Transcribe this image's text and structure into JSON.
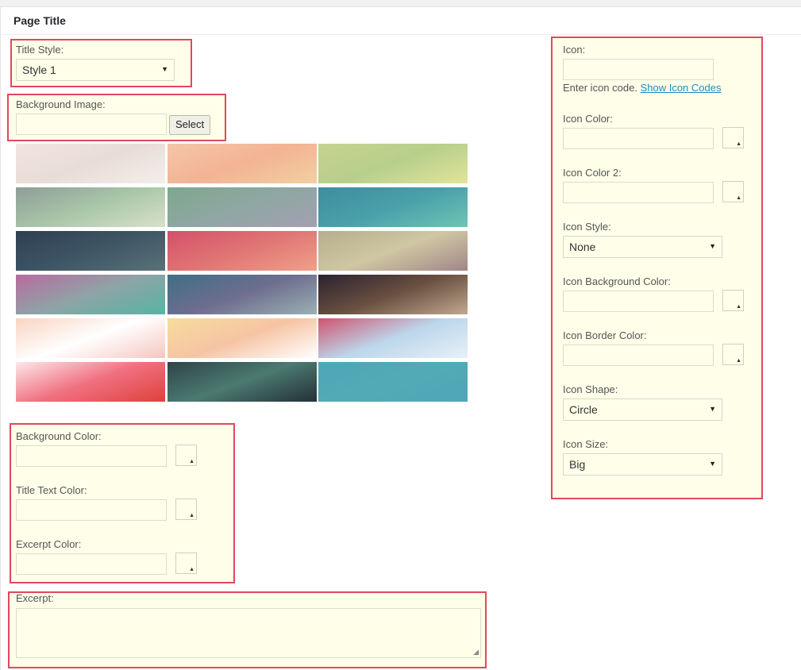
{
  "panel": {
    "title": "Page Title"
  },
  "title_style": {
    "label": "Title Style:",
    "value": "Style 1"
  },
  "background_image": {
    "label": "Background Image:",
    "value": "",
    "button": "Select"
  },
  "thumbnails": [
    {
      "name": "bg-thumb-1",
      "colors": [
        "#f2e4df",
        "#e8ddd6",
        "#f3eeea"
      ]
    },
    {
      "name": "bg-thumb-2",
      "colors": [
        "#f4c6a8",
        "#f3b394",
        "#f1d0a0"
      ]
    },
    {
      "name": "bg-thumb-3",
      "colors": [
        "#c6d390",
        "#b7cf8b",
        "#e1e49a"
      ]
    },
    {
      "name": "bg-thumb-4",
      "colors": [
        "#8f9d97",
        "#a8c6a8",
        "#d9e1c8"
      ]
    },
    {
      "name": "bg-thumb-5",
      "colors": [
        "#7fa78d",
        "#8fa7a3",
        "#a3a0b2"
      ]
    },
    {
      "name": "bg-thumb-6",
      "colors": [
        "#3f8ca0",
        "#4aa0aa",
        "#6fc4b4"
      ]
    },
    {
      "name": "bg-thumb-7",
      "colors": [
        "#2e3f52",
        "#3e5565",
        "#5a7278"
      ]
    },
    {
      "name": "bg-thumb-8",
      "colors": [
        "#d4506a",
        "#e07574",
        "#f0a08a"
      ]
    },
    {
      "name": "bg-thumb-9",
      "colors": [
        "#b6ae8c",
        "#cfc6a2",
        "#a1868a"
      ]
    },
    {
      "name": "bg-thumb-10",
      "colors": [
        "#b96aa0",
        "#8ea4a6",
        "#56b4a3"
      ]
    },
    {
      "name": "bg-thumb-11",
      "colors": [
        "#3f6e86",
        "#6e6e8e",
        "#9ab0b4"
      ]
    },
    {
      "name": "bg-thumb-12",
      "colors": [
        "#2a2230",
        "#6a5040",
        "#c0a890"
      ]
    },
    {
      "name": "bg-thumb-13",
      "colors": [
        "#f8d4c0",
        "#ffffff",
        "#f4c6c0"
      ]
    },
    {
      "name": "bg-thumb-14",
      "colors": [
        "#f7dc9c",
        "#f6c4a4",
        "#ffffff"
      ]
    },
    {
      "name": "bg-thumb-15",
      "colors": [
        "#d0536f",
        "#bcd6ea",
        "#e8f0f8"
      ]
    },
    {
      "name": "bg-thumb-16",
      "colors": [
        "#fce8ea",
        "#f07080",
        "#e0403c"
      ]
    },
    {
      "name": "bg-thumb-17",
      "colors": [
        "#2f4448",
        "#4b7a70",
        "#243036"
      ]
    },
    {
      "name": "bg-thumb-18",
      "colors": [
        "#4ea7b8",
        "#52aab6",
        "#4ea7b8"
      ]
    }
  ],
  "background_color": {
    "label": "Background Color:",
    "value": ""
  },
  "title_text_color": {
    "label": "Title Text Color:",
    "value": ""
  },
  "excerpt_color": {
    "label": "Excerpt Color:",
    "value": ""
  },
  "excerpt": {
    "label": "Excerpt:",
    "value": ""
  },
  "icon": {
    "label": "Icon:",
    "value": "",
    "help_text": "Enter icon code.",
    "help_link": "Show Icon Codes"
  },
  "icon_color": {
    "label": "Icon Color:",
    "value": ""
  },
  "icon_color_2": {
    "label": "Icon Color 2:",
    "value": ""
  },
  "icon_style": {
    "label": "Icon Style:",
    "value": "None"
  },
  "icon_background_color": {
    "label": "Icon Background Color:",
    "value": ""
  },
  "icon_border_color": {
    "label": "Icon Border Color:",
    "value": ""
  },
  "icon_shape": {
    "label": "Icon Shape:",
    "value": "Circle"
  },
  "icon_size": {
    "label": "Icon Size:",
    "value": "Big"
  },
  "icons": {
    "select_arrow": "dropdown-arrow-icon",
    "swatch_corner": "color-picker-icon",
    "resize_grip": "resize-grip-icon"
  },
  "theme": {
    "highlight_border": "#e2485d",
    "field_bg": "#fefee9",
    "link": "#1e8cbe"
  }
}
